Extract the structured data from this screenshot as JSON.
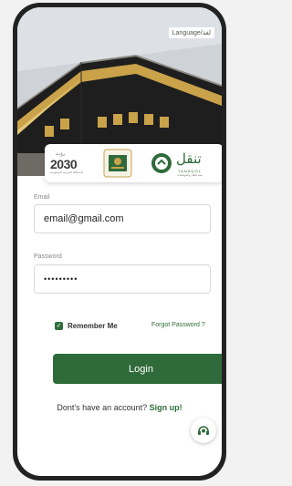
{
  "header": {
    "language_button": "Language/لغة"
  },
  "logos": {
    "vision": {
      "top_text": "رؤيـة",
      "number": "2030",
      "subtitle": "المملكة العربية السعودية"
    },
    "brand": {
      "arabic": "تنقل",
      "english": "TANAQOL",
      "sub": "هيئة النقل والمواصلات"
    }
  },
  "form": {
    "email_label": "Email",
    "email_value": "email@gmail.com",
    "password_label": "Password",
    "password_value": "•••••••••",
    "remember_label": "Remember Me",
    "forgot_label": "Forgot Password ?",
    "login_label": "Login",
    "signup_prefix": "Dont's have an account? ",
    "signup_link": "Sign up!"
  },
  "colors": {
    "primary": "#2f6b3a",
    "link": "#2f6e3a",
    "kaaba_black": "#1d1d1d",
    "gold": "#c9a24a"
  },
  "icons": {
    "support": "headset-icon",
    "check": "check-icon",
    "crest": "government-crest-icon",
    "brand": "tanaqol-logo-icon"
  }
}
